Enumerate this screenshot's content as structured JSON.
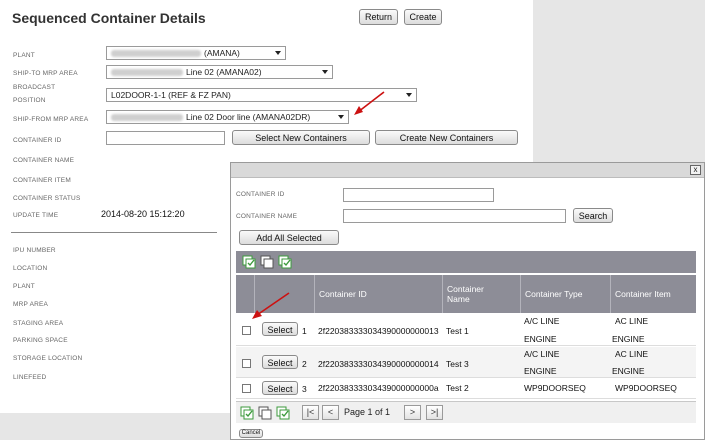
{
  "page": {
    "title": "Sequenced Container Details",
    "return_label": "Return",
    "create_label": "Create"
  },
  "form": {
    "plant_label": "PLANT",
    "plant_value": "(AMANA)",
    "ship_to_label": "SHIP-TO MRP AREA",
    "ship_to_value": "Line 02 (AMANA02)",
    "broadcast_label_1": "BROADCAST",
    "broadcast_label_2": "POSITION",
    "broadcast_value": "L02DOOR-1-1 (REF & FZ PAN)",
    "ship_from_label": "SHIP-FROM MRP AREA",
    "ship_from_value": "Line 02 Door line (AMANA02DR)",
    "container_id_label": "CONTAINER ID",
    "select_new_label": "Select New Containers",
    "create_new_label": "Create New Containers",
    "container_name_label": "CONTAINER NAME",
    "container_item_label": "CONTAINER ITEM",
    "container_status_label": "CONTAINER STATUS",
    "update_time_label": "UPDATE TIME",
    "update_time_value": "2014-08-20 15:12:20",
    "ipu_number_label": "IPU NUMBER",
    "location_label": "LOCATION",
    "plant2_label": "PLANT",
    "mrp_area_label": "MRP AREA",
    "staging_area_label": "STAGING AREA",
    "parking_space_label": "PARKING SPACE",
    "storage_location_label": "STORAGE LOCATION",
    "linefeed_label": "LINEFEED"
  },
  "dialog": {
    "close_label": "x",
    "container_id_label": "CONTAINER ID",
    "container_name_label": "CONTAINER NAME",
    "search_label": "Search",
    "add_all_label": "Add All Selected",
    "columns": {
      "id": "Container ID",
      "name_1": "Container",
      "name_2": "Name",
      "type": "Container Type",
      "item": "Container Item"
    },
    "select_label": "Select",
    "rows": [
      {
        "index": "1",
        "id": "2f220383333034390000000013",
        "name": "Test 1",
        "type_1": "A/C LINE",
        "type_2": "ENGINE",
        "item_1": "AC LINE",
        "item_2": "ENGINE"
      },
      {
        "index": "2",
        "id": "2f220383333034390000000014",
        "name": "Test 3",
        "type_1": "A/C LINE",
        "type_2": "ENGINE",
        "item_1": "AC LINE",
        "item_2": "ENGINE"
      },
      {
        "index": "3",
        "id": "2f22038333303439000000000a",
        "name": "Test 2",
        "type_1": "WP9DOORSEQ",
        "type_2": "",
        "item_1": "WP9DOORSEQ",
        "item_2": ""
      }
    ],
    "pager": {
      "first": "|<",
      "prev": "<",
      "text": "Page 1 of 1",
      "next": ">",
      "last": ">|"
    },
    "cancel_label": "Cancel"
  },
  "colors": {
    "grid_header": "#8d8d97",
    "panel_gray": "#e6e6e6",
    "arrow_red": "#cc1111",
    "icon_green": "#3c9a3c"
  },
  "icons": {
    "toolbar": [
      "select-all-icon",
      "copy-icon",
      "check-selected-icon"
    ],
    "pager_tools": [
      "select-all-icon",
      "copy-icon",
      "check-selected-icon"
    ]
  }
}
